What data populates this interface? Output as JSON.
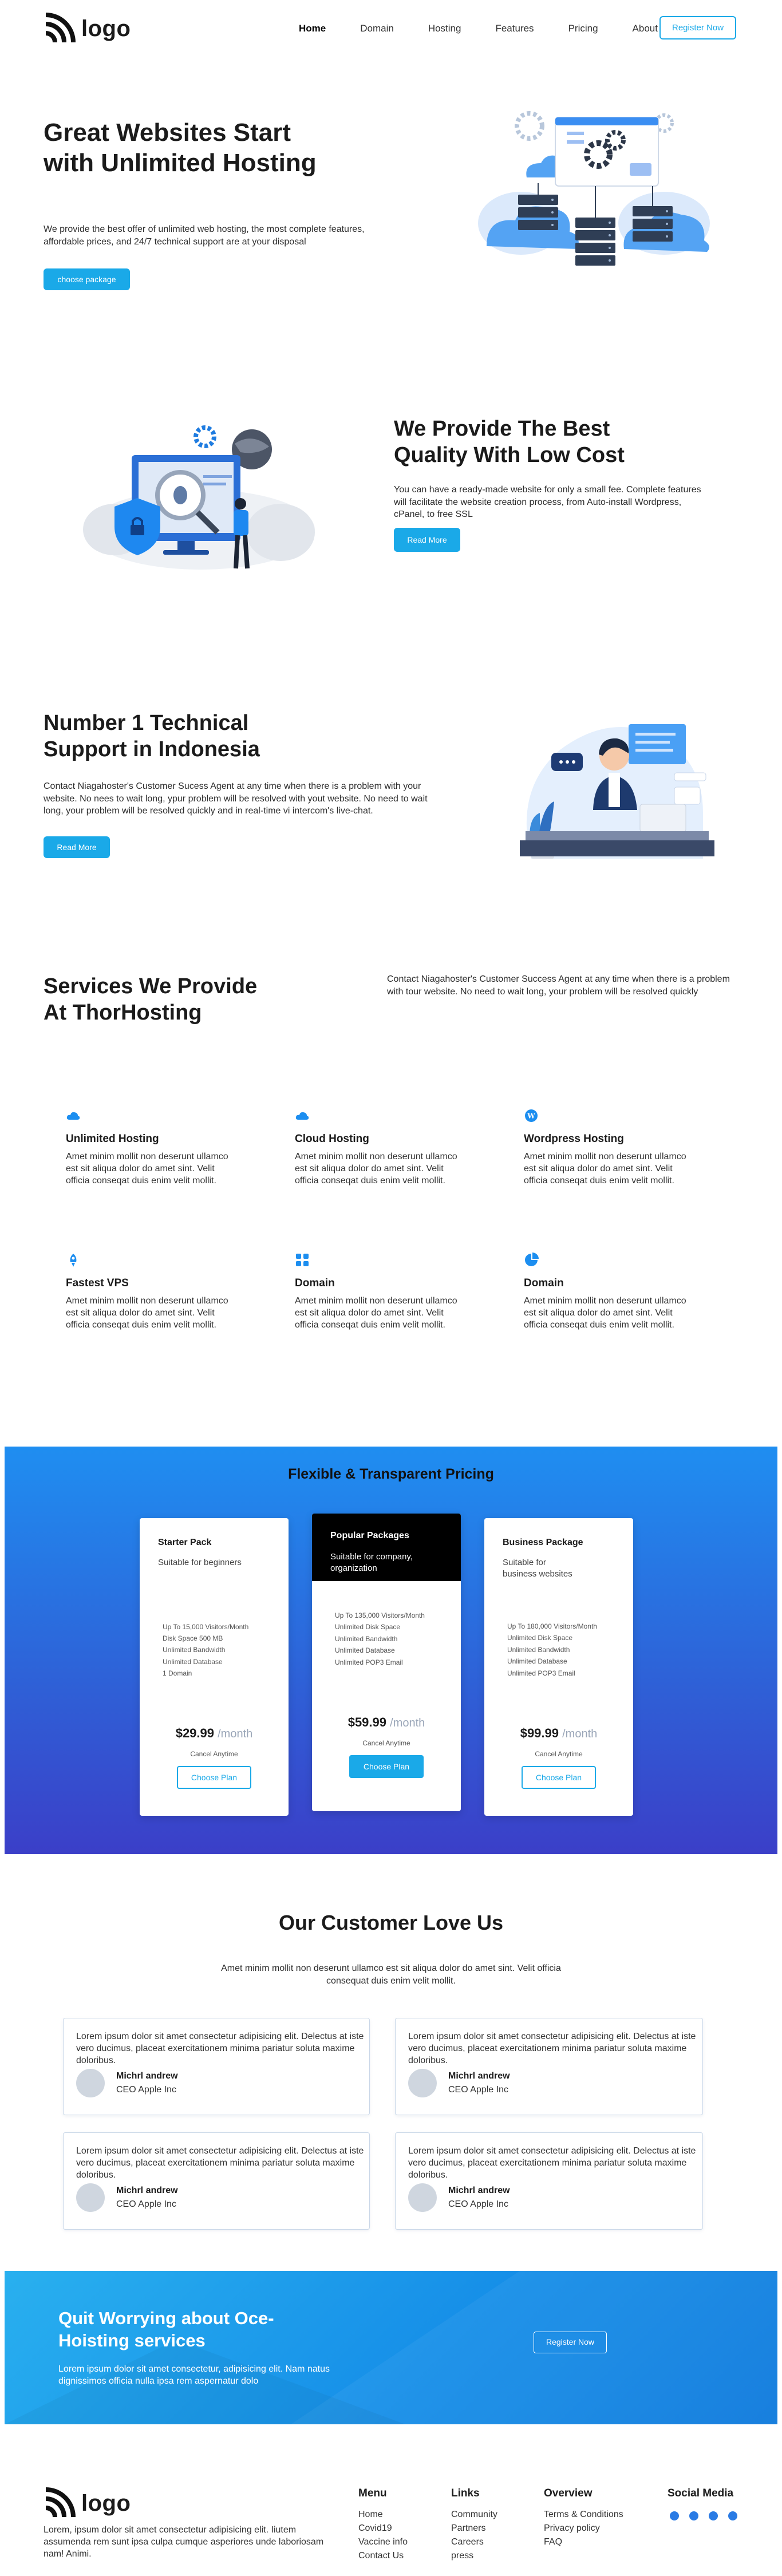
{
  "header": {
    "logo_text": "logo",
    "nav": [
      "Home",
      "Domain",
      "Hosting",
      "Features",
      "Pricing",
      "About Us"
    ],
    "register_label": "Register Now"
  },
  "hero": {
    "title": "Great Websites Start with Unlimited Hosting",
    "description": "We provide the best offer of unlimited web hosting, the most complete features, affordable prices, and 24/7 technical support are at your disposal",
    "button": "choose package"
  },
  "quality": {
    "title": "We Provide The Best Quality With Low Cost",
    "description": "You can have a ready-made website for only a small fee. Complete features will facilitate the website creation process, from Auto-install Wordpress, cPanel, to free SSL",
    "button": "Read More"
  },
  "support": {
    "title": "Number 1 Technical Support in Indonesia",
    "description": "Contact Niagahoster's Customer Sucess Agent at any time when there is a problem with your website. No nees to wait long, ypur problem will be resolved with yout website. No need to wait long, your problem will be resolved quickly and in real-time vi intercom's live-chat.",
    "button": "Read More"
  },
  "services": {
    "title": "Services We Provide At ThorHosting",
    "intro": "Contact Niagahoster's Customer Success Agent at any time when there is a problem with tour website. No need to wait long, your problem will be resolved quickly",
    "items": [
      {
        "icon": "cloud-icon",
        "title": "Unlimited Hosting",
        "desc": "Amet minim mollit non deserunt ullamco est sit aliqua dolor do amet sint. Velit officia conseqat duis enim velit mollit."
      },
      {
        "icon": "cloud-icon",
        "title": "Cloud Hosting",
        "desc": "Amet minim mollit non deserunt ullamco est sit aliqua dolor do amet sint. Velit officia conseqat duis enim velit mollit."
      },
      {
        "icon": "wordpress-icon",
        "title": "Wordpress Hosting",
        "desc": "Amet minim mollit non deserunt ullamco est sit aliqua dolor do amet sint. Velit officia conseqat duis enim velit mollit."
      },
      {
        "icon": "rocket-icon",
        "title": "Fastest VPS",
        "desc": "Amet minim mollit non deserunt ullamco est sit aliqua dolor do amet sint. Velit officia conseqat duis enim velit mollit."
      },
      {
        "icon": "grid-icon",
        "title": "Domain",
        "desc": "Amet minim mollit non deserunt ullamco est sit aliqua dolor do amet sint. Velit officia conseqat duis enim velit mollit."
      },
      {
        "icon": "pie-icon",
        "title": "Domain",
        "desc": "Amet minim mollit non deserunt ullamco est sit aliqua dolor do amet sint. Velit officia conseqat duis enim velit mollit."
      }
    ]
  },
  "pricing": {
    "title": "Flexible & Transparent Pricing",
    "plans": [
      {
        "name": "Starter Pack",
        "subtitle": "Suitable for beginners",
        "features": [
          "Up To 15,000 Visitors/Month",
          "Disk Space 500 MB",
          "Unlimited Bandwidth",
          "Unlimited Database",
          "1 Domain"
        ],
        "price": "$29.99",
        "period": "/month",
        "cancel": "Cancel Anytime",
        "button": "Choose Plan"
      },
      {
        "name": "Popular Packages",
        "subtitle": "Suitable for company, organization",
        "features": [
          "Up To 135,000 Visitors/Month",
          "Unlimited Disk Space",
          "Unlimited Bandwidth",
          "Unlimited Database",
          "Unlimited POP3 Email"
        ],
        "price": "$59.99",
        "period": "/month",
        "cancel": "Cancel Anytime",
        "button": "Choose Plan"
      },
      {
        "name": "Business Package",
        "subtitle": "Suitable for business websites",
        "features": [
          "Up To 180,000 Visitors/Month",
          "Unlimited Disk Space",
          "Unlimited Bandwidth",
          "Unlimited Database",
          "Unlimited POP3 Email"
        ],
        "price": "$99.99",
        "period": "/month",
        "cancel": "Cancel Anytime",
        "button": "Choose Plan"
      }
    ]
  },
  "testimonials": {
    "title": "Our Customer Love Us",
    "intro": "Amet minim mollit non deserunt ullamco est sit aliqua dolor do amet sint. Velit officia consequat duis enim velit mollit.",
    "items": [
      {
        "text": "Lorem ipsum dolor sit amet consectetur adipisicing elit. Delectus at iste vero ducimus, placeat exercitationem minima pariatur soluta maxime doloribus.",
        "name": "Michrl andrew",
        "role": "CEO Apple Inc"
      },
      {
        "text": "Lorem ipsum dolor sit amet consectetur adipisicing elit. Delectus at iste vero ducimus, placeat exercitationem minima pariatur soluta maxime doloribus.",
        "name": "Michrl andrew",
        "role": "CEO Apple Inc"
      },
      {
        "text": "Lorem ipsum dolor sit amet consectetur adipisicing elit. Delectus at iste vero ducimus, placeat exercitationem minima pariatur soluta maxime doloribus.",
        "name": "Michrl andrew",
        "role": "CEO Apple Inc"
      },
      {
        "text": "Lorem ipsum dolor sit amet consectetur adipisicing elit. Delectus at iste vero ducimus, placeat exercitationem minima pariatur soluta maxime doloribus.",
        "name": "Michrl andrew",
        "role": "CEO Apple Inc"
      }
    ]
  },
  "cta": {
    "title": "Quit Worrying about Oce-Hoisting services",
    "description": "Lorem ipsum dolor sit amet consectetur, adipisicing elit. Nam natus dignissimos officia nulla ipsa rem aspernatur dolo",
    "button": "Register Now"
  },
  "footer": {
    "logo_text": "logo",
    "about": "Lorem, ipsum dolor sit amet consectetur adipisicing elit. Iiutem assumenda rem sunt ipsa culpa cumque asperiores unde laboriosam nam! Animi.",
    "columns": [
      {
        "title": "Menu",
        "links": [
          "Home",
          "Covid19",
          "Vaccine info",
          "Contact Us"
        ]
      },
      {
        "title": "Links",
        "links": [
          "Community",
          "Partners",
          "Careers",
          "press"
        ]
      },
      {
        "title": "Overview",
        "links": [
          "Terms & Conditions",
          "Privacy policy",
          "FAQ"
        ]
      }
    ],
    "social_title": "Social Media",
    "social_icons": [
      "facebook-icon",
      "twitter-icon",
      "instagram-icon",
      "linkedin-icon"
    ]
  },
  "colors": {
    "accent": "#1aa9e8",
    "pricing_top": "#1f8ef1",
    "pricing_bottom": "#3b3fc8",
    "popular_header": "#000000"
  }
}
